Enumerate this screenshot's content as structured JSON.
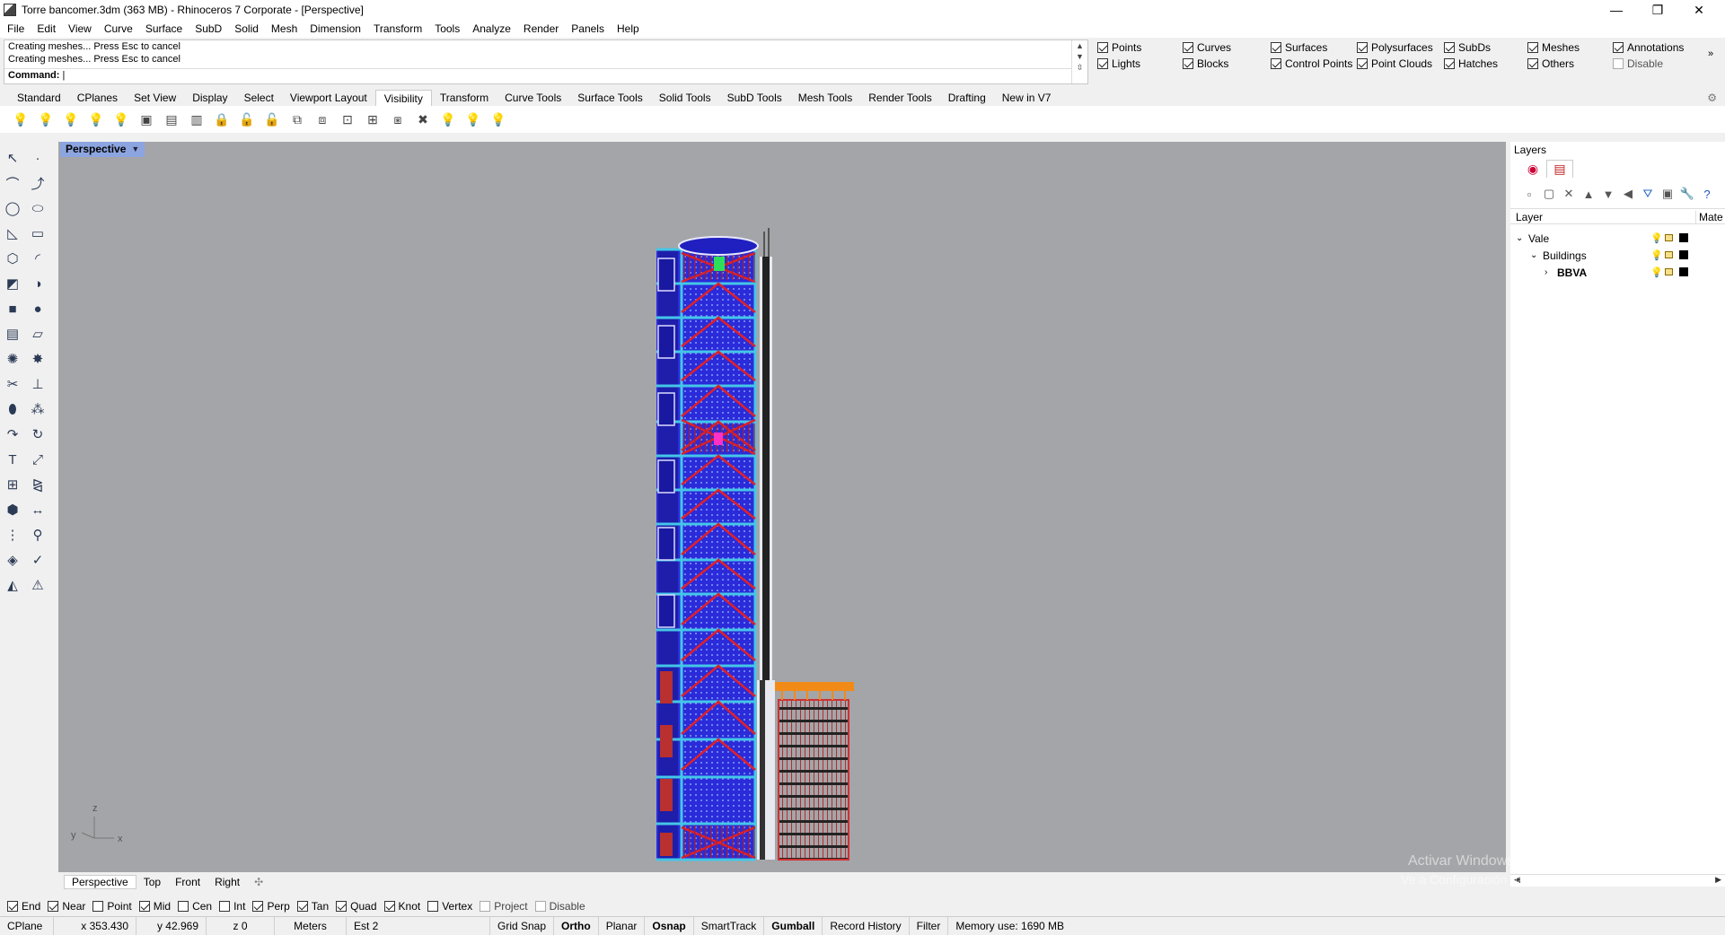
{
  "window": {
    "title": "Torre bancomer.3dm (363 MB) - Rhinoceros 7 Corporate - [Perspective]",
    "min_glyph": "—",
    "max_glyph": "❐",
    "close_glyph": "✕"
  },
  "menu": [
    "File",
    "Edit",
    "View",
    "Curve",
    "Surface",
    "SubD",
    "Solid",
    "Mesh",
    "Dimension",
    "Transform",
    "Tools",
    "Analyze",
    "Render",
    "Panels",
    "Help"
  ],
  "command": {
    "history": [
      "Creating meshes... Press Esc to cancel",
      "Creating meshes... Press Esc to cancel"
    ],
    "prompt": "Command:"
  },
  "filters": [
    {
      "label": "Points",
      "checked": true
    },
    {
      "label": "Curves",
      "checked": true
    },
    {
      "label": "Surfaces",
      "checked": true
    },
    {
      "label": "Polysurfaces",
      "checked": true
    },
    {
      "label": "SubDs",
      "checked": true
    },
    {
      "label": "Meshes",
      "checked": true
    },
    {
      "label": "Annotations",
      "checked": true
    },
    {
      "label": "Lights",
      "checked": true
    },
    {
      "label": "Blocks",
      "checked": true
    },
    {
      "label": "Control Points",
      "checked": true
    },
    {
      "label": "Point Clouds",
      "checked": true
    },
    {
      "label": "Hatches",
      "checked": true
    },
    {
      "label": "Others",
      "checked": true
    },
    {
      "label": "Disable",
      "checked": false
    }
  ],
  "toolbar_tabs": [
    "Standard",
    "CPlanes",
    "Set View",
    "Display",
    "Select",
    "Viewport Layout",
    "Visibility",
    "Transform",
    "Curve Tools",
    "Surface Tools",
    "Solid Tools",
    "SubD Tools",
    "Mesh Tools",
    "Render Tools",
    "Drafting",
    "New in V7"
  ],
  "active_toolbar_tab": "Visibility",
  "viewport": {
    "label": "Perspective",
    "axis_z": "z",
    "axis_x": "x",
    "axis_y": "y"
  },
  "view_tabs": [
    "Perspective",
    "Top",
    "Front",
    "Right"
  ],
  "osnaps": [
    {
      "label": "End",
      "checked": true
    },
    {
      "label": "Near",
      "checked": true
    },
    {
      "label": "Point",
      "checked": false
    },
    {
      "label": "Mid",
      "checked": true
    },
    {
      "label": "Cen",
      "checked": false
    },
    {
      "label": "Int",
      "checked": false
    },
    {
      "label": "Perp",
      "checked": true
    },
    {
      "label": "Tan",
      "checked": true
    },
    {
      "label": "Quad",
      "checked": true
    },
    {
      "label": "Knot",
      "checked": true
    },
    {
      "label": "Vertex",
      "checked": false
    },
    {
      "label": "Project",
      "checked": false
    },
    {
      "label": "Disable",
      "checked": false
    }
  ],
  "status": {
    "cplane": "CPlane",
    "x": "x 353.430",
    "y": "y 42.969",
    "z": "z 0",
    "units": "Meters",
    "layer": "Est 2",
    "grid_snap": "Grid Snap",
    "ortho": "Ortho",
    "planar": "Planar",
    "osnap": "Osnap",
    "smarttrack": "SmartTrack",
    "gumball": "Gumball",
    "record_history": "Record History",
    "filter": "Filter",
    "memory": "Memory use: 1690 MB"
  },
  "layers_panel": {
    "title": "Layers",
    "col_layer": "Layer",
    "col_material": "Mate",
    "rows": [
      {
        "name": "Vale",
        "expanded": true,
        "indent": 0
      },
      {
        "name": "Buildings",
        "expanded": true,
        "indent": 1
      },
      {
        "name": "BBVA",
        "expanded": false,
        "indent": 2,
        "current": true
      }
    ]
  },
  "watermark": {
    "line1": "Activar Windows",
    "line2": "Ve a Configuración para activar Windows."
  },
  "colors": {
    "viewport_bg": "#a4a5a8",
    "tower_blue": "#2b2bd9",
    "tower_frame": "#44c6e8",
    "brace_red": "#e0202a",
    "annex_orange": "#f28a18",
    "viewport_label_bg": "#8ca5e0"
  }
}
